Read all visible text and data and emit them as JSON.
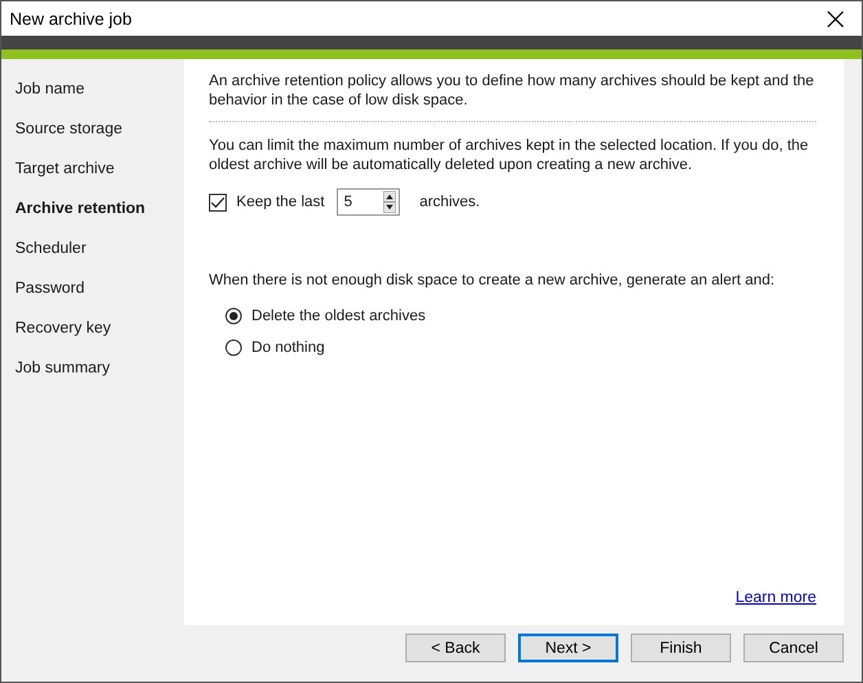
{
  "window": {
    "title": "New archive job"
  },
  "sidebar": {
    "items": [
      {
        "label": "Job name",
        "selected": false
      },
      {
        "label": "Source storage",
        "selected": false
      },
      {
        "label": "Target archive",
        "selected": false
      },
      {
        "label": "Archive retention",
        "selected": true
      },
      {
        "label": "Scheduler",
        "selected": false
      },
      {
        "label": "Password",
        "selected": false
      },
      {
        "label": "Recovery key",
        "selected": false
      },
      {
        "label": "Job summary",
        "selected": false
      }
    ]
  },
  "content": {
    "intro": "An archive retention policy allows you to define how many archives should be kept and the behavior in the case of low disk space.",
    "limit_text": "You can limit the maximum number of archives kept in the selected location. If you do, the oldest archive will be automatically deleted upon creating a new archive.",
    "keep": {
      "label": "Keep the last",
      "checked": true,
      "value": "5",
      "suffix": "archives."
    },
    "alert_text": "When there is not enough disk space to create a new archive, generate an alert and:",
    "options": [
      {
        "label": "Delete the oldest archives",
        "selected": true
      },
      {
        "label": "Do nothing",
        "selected": false
      }
    ],
    "link": "Learn more"
  },
  "buttons": [
    {
      "label": "< Back",
      "default": false
    },
    {
      "label": "Next >",
      "default": true
    },
    {
      "label": "Finish",
      "default": false
    },
    {
      "label": "Cancel",
      "default": false
    }
  ]
}
